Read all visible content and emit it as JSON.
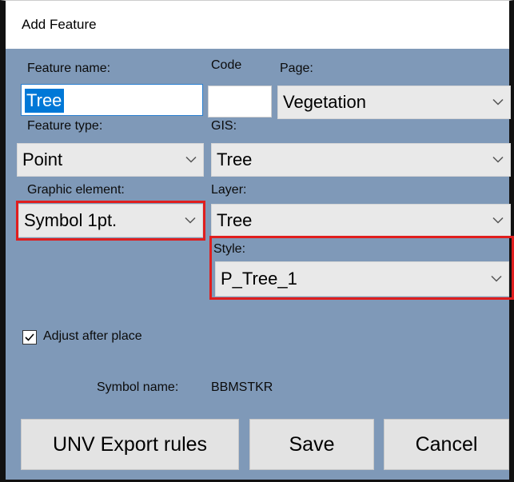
{
  "window": {
    "title": "Add Feature"
  },
  "labels": {
    "feature_name": "Feature name:",
    "code": "Code",
    "page": "Page:",
    "feature_type": "Feature type:",
    "gis": "GIS:",
    "graphic_element": "Graphic element:",
    "layer": "Layer:",
    "style": "Style:",
    "symbol_name": "Symbol name:"
  },
  "fields": {
    "feature_name_value": "Tree",
    "code_value": "",
    "page_value": "Vegetation",
    "feature_type_value": "Point",
    "gis_value": "Tree",
    "graphic_element_value": "Symbol 1pt.",
    "layer_value": "Tree",
    "style_value": "P_Tree_1"
  },
  "checkbox": {
    "label": "Adjust after place",
    "checked": true
  },
  "symbol": {
    "value": "BBMSTKR"
  },
  "buttons": {
    "export": "UNV Export rules",
    "save": "Save",
    "cancel": "Cancel"
  },
  "icons": {
    "dropdown": "chevron-down-icon",
    "check": "checkmark-icon"
  },
  "colors": {
    "background": "#7f99b8",
    "highlight": "#e01e1e",
    "selection": "#0078d7"
  }
}
